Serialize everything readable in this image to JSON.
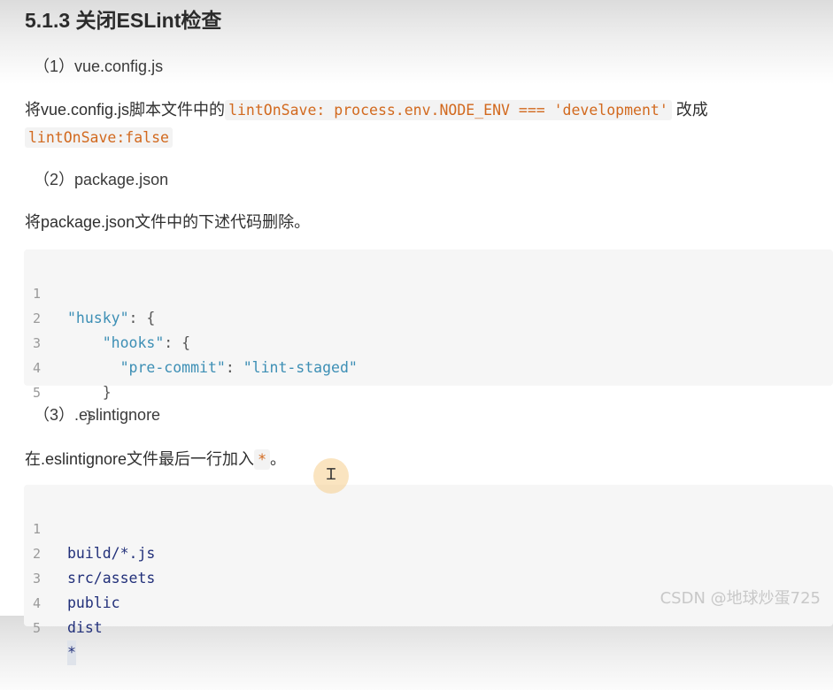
{
  "heading": "5.1.3 关闭ESLint检查",
  "section1": {
    "title": "（1）vue.config.js",
    "text_before": "将vue.config.js脚本文件中的",
    "code1": "lintOnSave: process.env.NODE_ENV === 'development'",
    "text_middle": " 改成",
    "code2": "lintOnSave:false"
  },
  "section2": {
    "title": "（2）package.json",
    "text": "将package.json文件中的下述代码删除。",
    "code_lines": [
      {
        "num": "1",
        "indent": "",
        "key": "\"husky\"",
        "rest": ": {"
      },
      {
        "num": "2",
        "indent": "    ",
        "key": "\"hooks\"",
        "rest": ": {"
      },
      {
        "num": "3",
        "indent": "      ",
        "key": "\"pre-commit\"",
        "rest": ": ",
        "value": "\"lint-staged\""
      },
      {
        "num": "4",
        "indent": "    ",
        "key": "",
        "rest": "}"
      },
      {
        "num": "5",
        "indent": "  ",
        "key": "",
        "rest": "}"
      }
    ]
  },
  "section3": {
    "title": "（3）.eslintignore",
    "text_before": "在.eslintignore文件最后一行加入",
    "code": "*",
    "text_after": "。",
    "code_lines": [
      {
        "num": "1",
        "text": "build/*.js"
      },
      {
        "num": "2",
        "text": "src/assets"
      },
      {
        "num": "3",
        "text": "public"
      },
      {
        "num": "4",
        "text": "dist"
      },
      {
        "num": "5",
        "text": "*"
      }
    ]
  },
  "watermark": "CSDN @地球炒蛋725",
  "cursor_icon": "text-cursor-icon"
}
